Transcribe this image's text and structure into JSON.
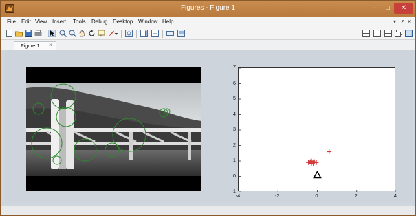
{
  "window": {
    "title": "Figures - Figure 1",
    "min_glyph": "–",
    "max_glyph": "□",
    "close_glyph": "✕"
  },
  "menubar": {
    "items": [
      "File",
      "Edit",
      "View",
      "Insert",
      "Tools",
      "Debug",
      "Desktop",
      "Window",
      "Help"
    ],
    "right_glyphs": [
      "▾",
      "↗",
      "✕"
    ]
  },
  "toolbar": {
    "left_icons": [
      "new-figure-icon",
      "open-file-icon",
      "save-icon",
      "print-icon",
      "pointer-icon",
      "zoom-in-icon",
      "zoom-out-icon",
      "pan-icon",
      "rotate-icon",
      "data-cursor-icon",
      "brush-icon",
      "brush-dropdown-icon",
      "link-plot-icon",
      "insert-colorbar-icon",
      "insert-legend-icon",
      "hide-plot-tools-icon",
      "show-plot-tools-icon"
    ],
    "right_icons": [
      "tile-grid-icon",
      "tile-columns-icon",
      "tile-rows-icon",
      "float-icon",
      "dock-icon"
    ]
  },
  "tabs": [
    {
      "label": "Figure 1"
    }
  ],
  "chart_data": {
    "type": "scatter",
    "title": "",
    "xlabel": "",
    "ylabel": "",
    "xlim": [
      -4,
      4
    ],
    "ylim": [
      -1,
      7
    ],
    "xticks": [
      -4,
      -2,
      0,
      2,
      4
    ],
    "yticks": [
      -1,
      0,
      1,
      2,
      3,
      4,
      5,
      6,
      7
    ],
    "grid": false,
    "series": [
      {
        "marker": "+",
        "color": "#d23a3a",
        "x": [
          0.6,
          -0.45,
          -0.35,
          -0.3,
          -0.2,
          -0.15,
          -0.05,
          -0.3,
          -0.2
        ],
        "y": [
          1.6,
          0.9,
          0.95,
          0.85,
          0.9,
          0.95,
          0.9,
          1.0,
          0.8
        ]
      },
      {
        "marker": "triangle",
        "color": "#000000",
        "x": [
          0.0
        ],
        "y": [
          0.0
        ]
      }
    ]
  }
}
